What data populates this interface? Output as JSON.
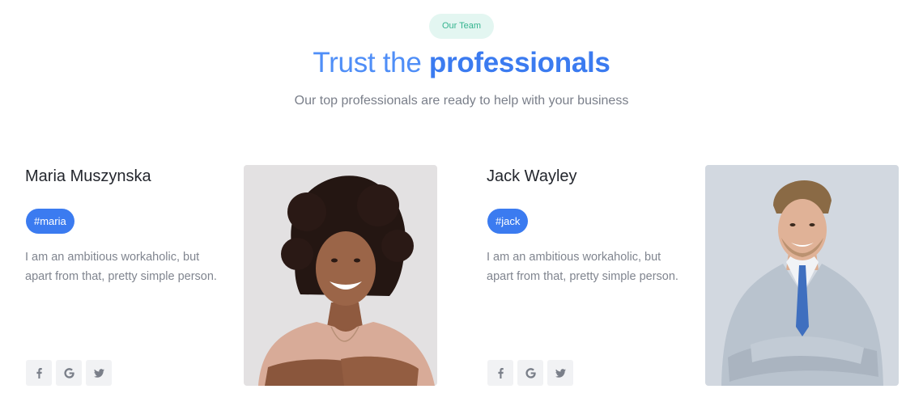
{
  "section": {
    "badge": "Our Team",
    "title_light": "Trust the ",
    "title_bold": "professionals",
    "subtitle": "Our top professionals are ready to help with your business"
  },
  "team": [
    {
      "name": "Maria Muszynska",
      "tag": "#maria",
      "bio": "I am an ambitious workaholic, but apart from that, pretty simple person.",
      "socials": [
        "facebook-icon",
        "google-icon",
        "twitter-icon"
      ]
    },
    {
      "name": "Jack Wayley",
      "tag": "#jack",
      "bio": "I am an ambitious workaholic, but apart from that, pretty simple person.",
      "socials": [
        "facebook-icon",
        "google-icon",
        "twitter-icon"
      ]
    }
  ],
  "colors": {
    "accent": "#3b7bf0",
    "badge_bg": "#e3f6f1",
    "badge_text": "#35b48f",
    "social_bg": "#f1f2f4"
  }
}
